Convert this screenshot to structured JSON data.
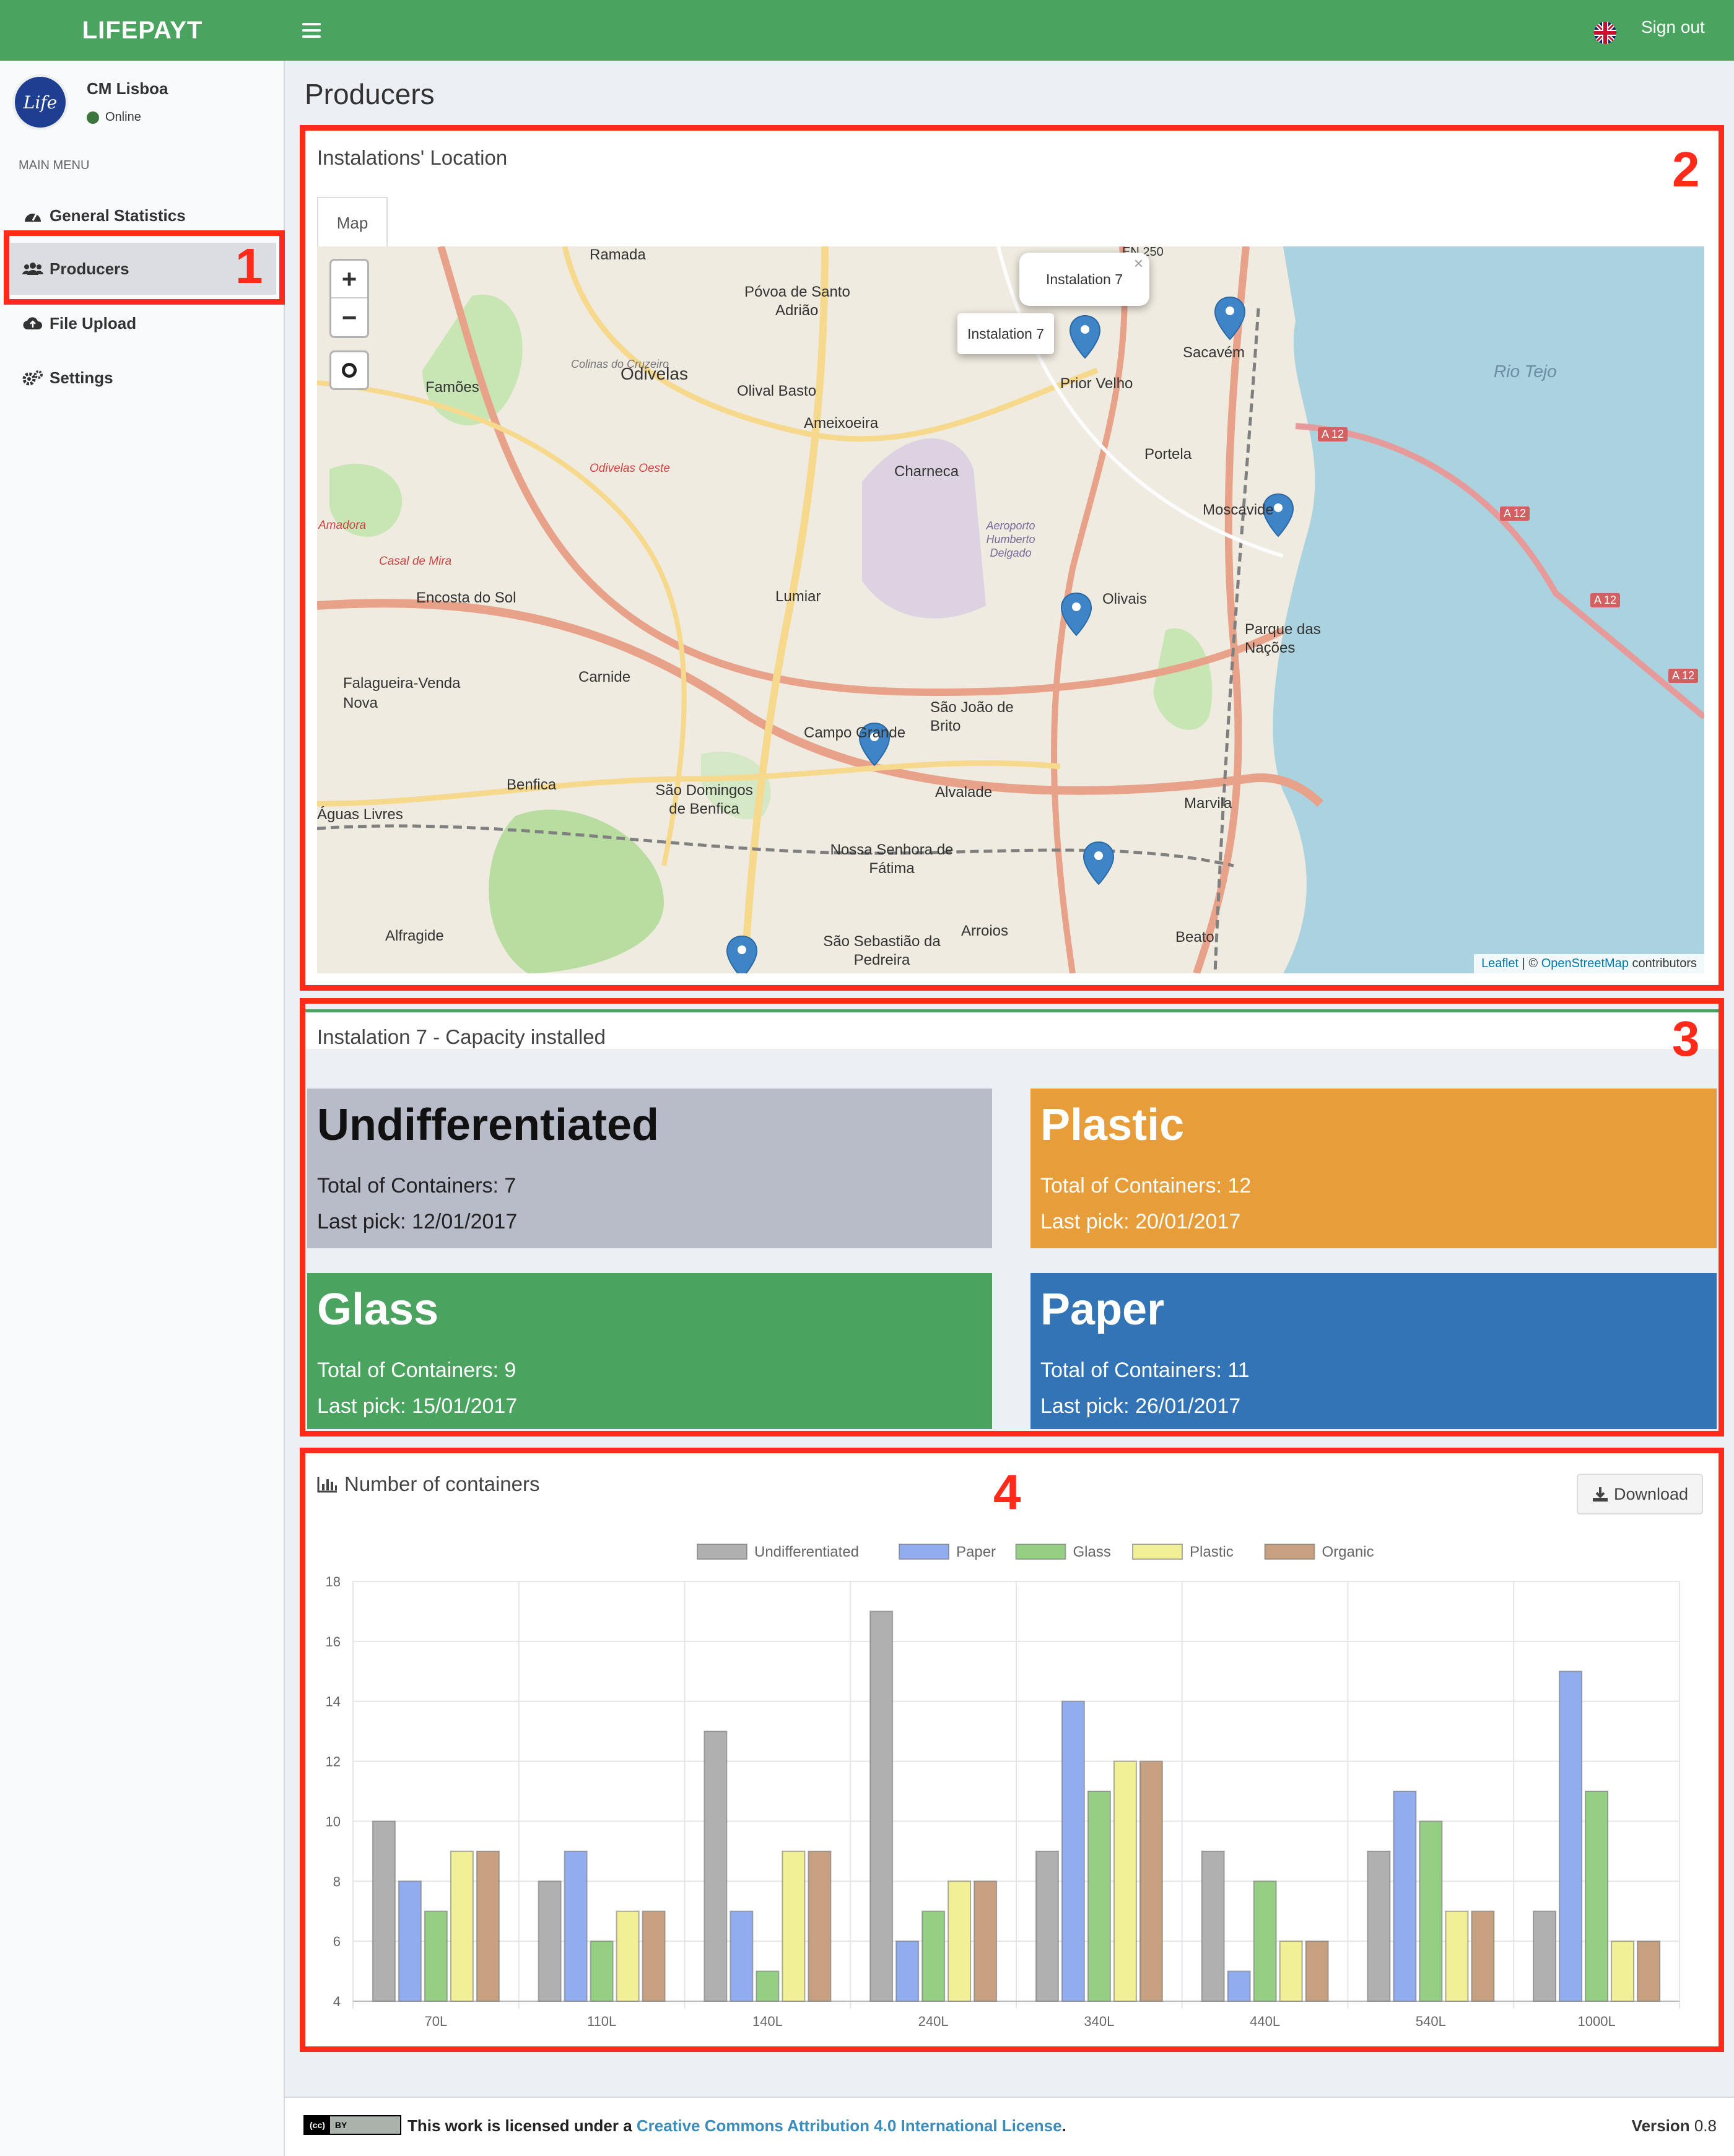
{
  "header": {
    "brand": "LIFEPAYT",
    "signout": "Sign out"
  },
  "sidebar": {
    "user_name": "CM Lisboa",
    "user_status": "Online",
    "menu_header": "MAIN MENU",
    "items": [
      {
        "label": "General Statistics",
        "icon": "dashboard-icon"
      },
      {
        "label": "Producers",
        "icon": "users-icon",
        "active": true
      },
      {
        "label": "File Upload",
        "icon": "cloud-upload-icon"
      },
      {
        "label": "Settings",
        "icon": "gears-icon"
      }
    ],
    "avatar_text": "Life"
  },
  "page": {
    "title": "Producers"
  },
  "annotations": [
    "1",
    "2",
    "3",
    "4"
  ],
  "map_box": {
    "title": "Instalations' Location",
    "tab": "Map",
    "zoom_in": "+",
    "zoom_out": "−",
    "popups": [
      "Instalation 7",
      "Instalation 7"
    ],
    "attribution_leaflet": "Leaflet",
    "attribution_sep": " | © ",
    "attribution_osm": "OpenStreetMap",
    "attribution_suffix": " contributors",
    "labels": {
      "ramada": "Ramada",
      "povoa": "Póvoa de Santo",
      "adriao": "Adrião",
      "en250": "EN 250",
      "famoes": "Famões",
      "odivelas": "Odivelas",
      "colinas": "Colinas do Cruzeiro",
      "olival": "Olival Basto",
      "ameixoeira": "Ameixoeira",
      "charneca": "Charneca",
      "prior": "Prior Velho",
      "sacavem": "Sacavém",
      "riotejo": "Rio Tejo",
      "a12": "A 12",
      "portela": "Portela",
      "moscavide": "Moscavide",
      "odivelas_oeste": "Odivelas Oeste",
      "amadora": "Amadora",
      "casal": "Casal de Mira",
      "encosta": "Encosta do Sol",
      "lumiar": "Lumiar",
      "olivais": "Olivais",
      "parque": "Parque das Nações",
      "falagueira": "Falagueira-Venda Nova",
      "carnide": "Carnide",
      "sjoao": "São João de Brito",
      "campo": "Campo Grande",
      "benfica": "Benfica",
      "sdomingos": "São Domingos de Benfica",
      "alvalade": "Alvalade",
      "marvila": "Marvila",
      "aguas": "Águas Livres",
      "nsf": "Nossa Senhora de Fátima",
      "alfragide": "Alfragide",
      "arroios": "Arroios",
      "ssebastiao": "São Sebastião da Pedreira",
      "beato": "Beato",
      "aeroporto": "Aeroporto Humberto Delgado"
    }
  },
  "capacity": {
    "title": "Instalation 7 - Capacity installed",
    "cards": [
      {
        "name": "Undifferentiated",
        "containers": "Total of Containers: 7",
        "last": "Last pick: 12/01/2017",
        "color": "#b8bcc8"
      },
      {
        "name": "Plastic",
        "containers": "Total of Containers: 12",
        "last": "Last pick: 20/01/2017",
        "color": "#e69d3a"
      },
      {
        "name": "Glass",
        "containers": "Total of Containers: 9",
        "last": "Last pick: 15/01/2017",
        "color": "#4aa35f"
      },
      {
        "name": "Paper",
        "containers": "Total of Containers: 11",
        "last": "Last pick: 26/01/2017",
        "color": "#3274b5"
      }
    ]
  },
  "chart_box": {
    "title": "Number of containers",
    "download": "Download"
  },
  "chart_data": {
    "type": "bar",
    "categories": [
      "70L",
      "110L",
      "140L",
      "240L",
      "340L",
      "440L",
      "540L",
      "1000L"
    ],
    "series": [
      {
        "name": "Undifferentiated",
        "values": [
          10,
          8,
          13,
          17,
          9,
          9,
          9,
          7
        ],
        "color": "#b0b0b0"
      },
      {
        "name": "Paper",
        "values": [
          8,
          9,
          7,
          6,
          14,
          5,
          11,
          15
        ],
        "color": "#91adf0"
      },
      {
        "name": "Glass",
        "values": [
          7,
          6,
          5,
          7,
          11,
          8,
          10,
          11
        ],
        "color": "#95cf84"
      },
      {
        "name": "Plastic",
        "values": [
          9,
          7,
          9,
          8,
          12,
          6,
          7,
          6
        ],
        "color": "#f2f096"
      },
      {
        "name": "Organic",
        "values": [
          9,
          7,
          9,
          8,
          12,
          6,
          7,
          6
        ],
        "color": "#c7a080"
      }
    ],
    "yticks": [
      4,
      6,
      8,
      10,
      12,
      14,
      16,
      18
    ],
    "ylim": [
      4,
      18
    ],
    "legend": "top",
    "grid": true
  },
  "footer": {
    "license_prefix": "This work is licensed under a ",
    "license_link": "Creative Commons Attribution 4.0 International License",
    "license_suffix": ".",
    "version_label": "Version",
    "version_value": "0.8",
    "cc_badge": "BY"
  }
}
